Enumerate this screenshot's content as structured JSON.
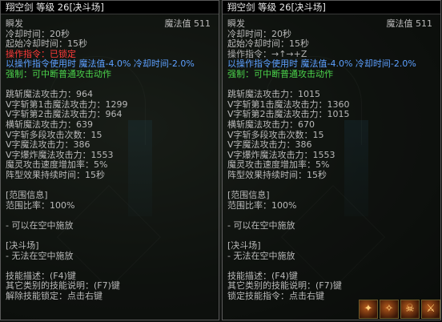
{
  "left": {
    "title": "翔空剑 等级 26[决斗场]",
    "cast_type": "瞬发",
    "mana_label": "魔法值 511",
    "cooldown": "冷却时间：20秒",
    "start_cooldown": "起始冷却时间：15秒",
    "command_label": "操作指令：已锁定",
    "command_bonus": "以操作指令使用时 魔法值-4.0% 冷却时间-2.0%",
    "strong": "强制：可中断普通攻击动作",
    "stats": [
      "跳斩魔法攻击力：964",
      "V字斩第1击魔法攻击力：1299",
      "V字斩第2击魔法攻击力：964",
      "横斩魔法攻击力：639",
      "V字斩多段攻击次数：15",
      "V字魔法攻击力：386",
      "V字爆炸魔法攻击力：1553",
      "魔灵攻击速度增加率：5%",
      "阵型效果持续时间：15秒"
    ],
    "range_header": "[范围信息]",
    "range_ratio": "范围比率：100%",
    "air_cast": "- 可以在空中施放",
    "duel_header": "[决斗场]",
    "duel_note": "- 无法在空中施放",
    "hint1": "技能描述：(F4)键",
    "hint2": "其它类别的技能说明：(F7)键",
    "hint3": "解除技能锁定：点击右键"
  },
  "right": {
    "title": "翔空剑 等级 26[决斗场]",
    "cast_type": "瞬发",
    "mana_label": "魔法值 511",
    "cooldown": "冷却时间：20秒",
    "start_cooldown": "起始冷却时间：15秒",
    "command_label": "操作指令：→↑→+Z",
    "command_bonus": "以操作指令使用时 魔法值-4.0% 冷却时间-2.0%",
    "strong": "强制：可中断普通攻击动作",
    "stats": [
      "跳斩魔法攻击力：1015",
      "V字斩第1击魔法攻击力：1360",
      "V字斩第2击魔法攻击力：1015",
      "横斩魔法攻击力：670",
      "V字斩多段攻击次数：15",
      "V字魔法攻击力：386",
      "V字爆炸魔法攻击力：1553",
      "魔灵攻击速度增加率：5%",
      "阵型效果持续时间：15秒"
    ],
    "range_header": "[范围信息]",
    "range_ratio": "范围比率：100%",
    "air_cast": "- 可以在空中施放",
    "duel_header": "[决斗场]",
    "duel_note": "- 无法在空中施放",
    "hint1": "技能描述：(F4)键",
    "hint2": "其它类别的技能说明：(F7)键",
    "hint3": "锁定技能指令：点击右键"
  },
  "toolbar": {
    "icons": [
      "fire-skill-icon",
      "claw-skill-icon",
      "skull-skill-icon",
      "blade-skill-icon"
    ]
  },
  "colors": {
    "red": "#ff3b3b",
    "blue": "#5da0ff",
    "green": "#4bd24b",
    "text": "#b9b9b9"
  }
}
